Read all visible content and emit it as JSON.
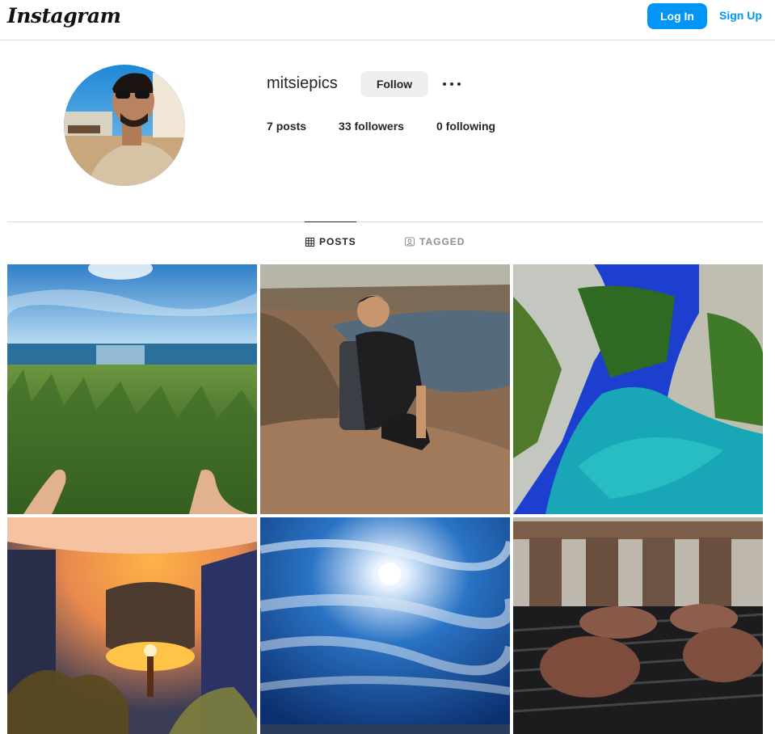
{
  "header": {
    "logo": "Instagram",
    "login_label": "Log In",
    "signup_label": "Sign Up"
  },
  "profile": {
    "username": "mitsiepics",
    "follow_label": "Follow",
    "stats": {
      "posts_count": "7",
      "posts_label": "posts",
      "followers_count": "33",
      "followers_label": "followers",
      "following_count": "0",
      "following_label": "following"
    }
  },
  "tabs": [
    {
      "label": "POSTS",
      "icon": "grid-icon",
      "active": true
    },
    {
      "label": "TAGGED",
      "icon": "tagged-icon",
      "active": false
    }
  ],
  "posts": [
    {
      "subject": "grass-and-sea-with-feet"
    },
    {
      "subject": "man-with-backpack-overlooking-lake"
    },
    {
      "subject": "turquoise-river-in-gorge"
    },
    {
      "subject": "lamp-glowing-in-corner"
    },
    {
      "subject": "sun-through-wispy-clouds"
    },
    {
      "subject": "burgers-on-grill"
    }
  ],
  "colors": {
    "accent": "#0095f6",
    "border": "#dbdbdb",
    "muted_text": "#8e8e8e"
  }
}
